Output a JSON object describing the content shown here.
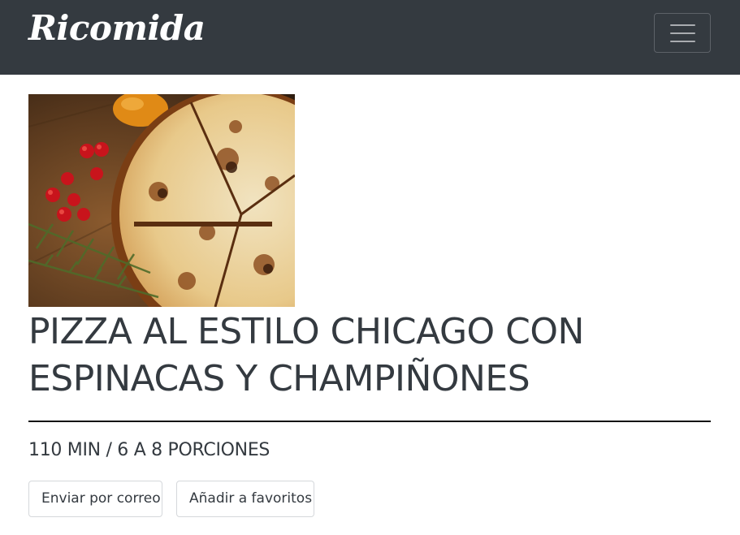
{
  "navbar": {
    "brand": "Ricomida",
    "toggler_icon": "hamburger-menu-icon"
  },
  "recipe": {
    "image_alt": "pizza",
    "title": "PIZZA AL ESTILO CHICAGO CON ESPINACAS Y CHAMPIÑONES",
    "meta": "110 MIN / 6 A 8 PORCIONES",
    "actions": {
      "email_label": "Enviar por correo",
      "favorite_label": "Añadir a favoritos"
    }
  },
  "colors": {
    "navbar_bg": "#343a40",
    "text": "#343a40",
    "divider": "#111111"
  }
}
